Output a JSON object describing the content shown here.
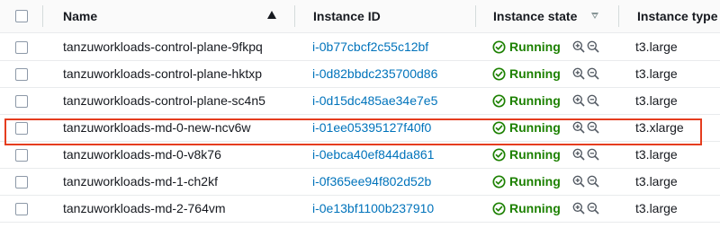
{
  "colors": {
    "link": "#0073bb",
    "running": "#1d8102",
    "highlight_border": "#e53d1f"
  },
  "columns": {
    "name": "Name",
    "instance_id": "Instance ID",
    "instance_state": "Instance state",
    "instance_type": "Instance type"
  },
  "sort": {
    "name_direction": "ascending"
  },
  "rows": [
    {
      "name": "tanzuworkloads-control-plane-9fkpq",
      "instance_id": "i-0b77cbcf2c55c12bf",
      "state": "Running",
      "type": "t3.large"
    },
    {
      "name": "tanzuworkloads-control-plane-hktxp",
      "instance_id": "i-0d82bbdc235700d86",
      "state": "Running",
      "type": "t3.large"
    },
    {
      "name": "tanzuworkloads-control-plane-sc4n5",
      "instance_id": "i-0d15dc485ae34e7e5",
      "state": "Running",
      "type": "t3.large"
    },
    {
      "name": "tanzuworkloads-md-0-new-ncv6w",
      "instance_id": "i-01ee05395127f40f0",
      "state": "Running",
      "type": "t3.xlarge",
      "highlighted": true
    },
    {
      "name": "tanzuworkloads-md-0-v8k76",
      "instance_id": "i-0ebca40ef844da861",
      "state": "Running",
      "type": "t3.large"
    },
    {
      "name": "tanzuworkloads-md-1-ch2kf",
      "instance_id": "i-0f365ee94f802d52b",
      "state": "Running",
      "type": "t3.large"
    },
    {
      "name": "tanzuworkloads-md-2-764vm",
      "instance_id": "i-0e13bf1100b237910",
      "state": "Running",
      "type": "t3.large"
    }
  ]
}
